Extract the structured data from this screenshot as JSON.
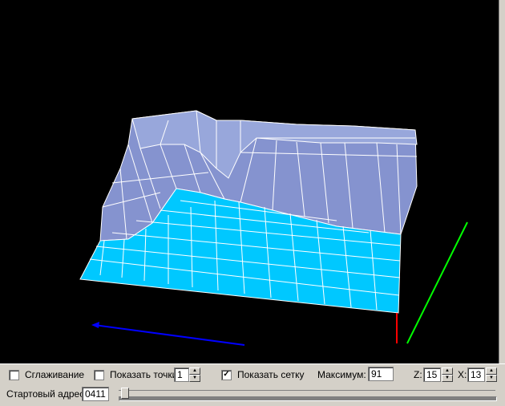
{
  "toolbar": {
    "smoothing": {
      "label": "Сглаживание",
      "checked": false
    },
    "show_points": {
      "label": "Показать точки",
      "checked": false,
      "value": "1"
    },
    "show_grid": {
      "label": "Показать сетку",
      "checked": true
    },
    "maximum": {
      "label": "Максимум:",
      "value": "91"
    },
    "z": {
      "label": "Z:",
      "value": "15"
    },
    "x": {
      "label": "X:",
      "value": "13"
    },
    "start_address": {
      "label": "Стартовый адрес:",
      "value": "0411"
    },
    "address_slider": {
      "position": 0.01
    }
  },
  "viewport": {
    "surface_color": "#00c0ff",
    "wall_color": "#8c9cd4",
    "grid_color": "#ffffff",
    "axis_colors": {
      "x": "#0000ff",
      "y": "#00ff00",
      "z": "#ff0000"
    }
  }
}
